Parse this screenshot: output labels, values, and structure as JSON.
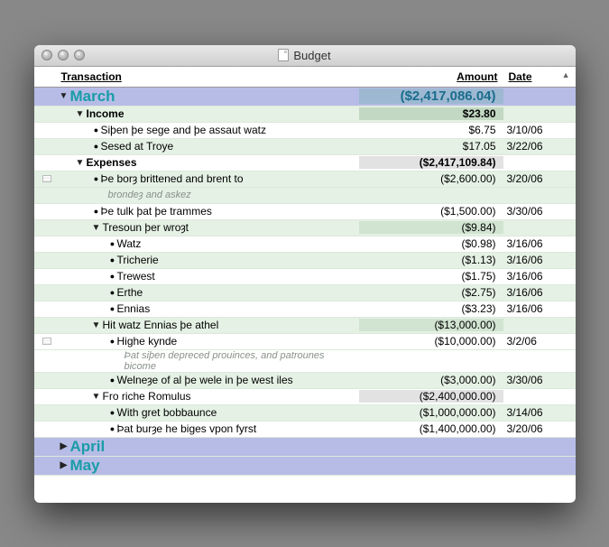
{
  "window": {
    "title": "Budget"
  },
  "columns": {
    "transaction": "Transaction",
    "amount": "Amount",
    "date": "Date"
  },
  "months": {
    "march": {
      "label": "March",
      "total": "($2,417,086.04)"
    },
    "april": {
      "label": "April"
    },
    "may": {
      "label": "May"
    }
  },
  "income": {
    "label": "Income",
    "total": "$23.80",
    "items": [
      {
        "label": "Siþen þe sege and þe assaut watz",
        "amount": "$6.75",
        "date": "3/10/06"
      },
      {
        "label": "Sesed at Troye",
        "amount": "$17.05",
        "date": "3/22/06"
      }
    ]
  },
  "expenses": {
    "label": "Expenses",
    "total": "($2,417,109.84)",
    "items": {
      "borz": {
        "label": "Þe borȝ brittened and brent to",
        "note": "brondeȝ and askez",
        "amount": "($2,600.00)",
        "date": "3/20/06"
      },
      "tulk": {
        "label": "Þe tulk þat þe trammes",
        "amount": "($1,500.00)",
        "date": "3/30/06"
      },
      "tresoun": {
        "label": "Tresoun þer wroȝt",
        "amount": "($9.84)",
        "children": [
          {
            "label": "Watz",
            "amount": "($0.98)",
            "date": "3/16/06"
          },
          {
            "label": "Tricherie",
            "amount": "($1.13)",
            "date": "3/16/06"
          },
          {
            "label": "Trewest",
            "amount": "($1.75)",
            "date": "3/16/06"
          },
          {
            "label": "Erthe",
            "amount": "($2.75)",
            "date": "3/16/06"
          },
          {
            "label": "Ennias",
            "amount": "($3.23)",
            "date": "3/16/06"
          }
        ]
      },
      "ennias": {
        "label": "Hit watz Ennias þe athel",
        "amount": "($13,000.00)",
        "children": {
          "highe": {
            "label": "Highe kynde",
            "note": "Þat siþen depreced prouinces, and patrounes bicome",
            "amount": "($10,000.00)",
            "date": "3/2/06"
          },
          "welneze": {
            "label": "Welneȝe of al þe wele in þe west iles",
            "amount": "($3,000.00)",
            "date": "3/30/06"
          }
        }
      },
      "romulus": {
        "label": "Fro riche Romulus",
        "amount": "($2,400,000.00)",
        "children": [
          {
            "label": "With gret bobbaunce",
            "amount": "($1,000,000.00)",
            "date": "3/14/06"
          },
          {
            "label": "Þat burȝe he biges vpon fyrst",
            "amount": "($1,400,000.00)",
            "date": "3/20/06"
          }
        ]
      }
    }
  }
}
